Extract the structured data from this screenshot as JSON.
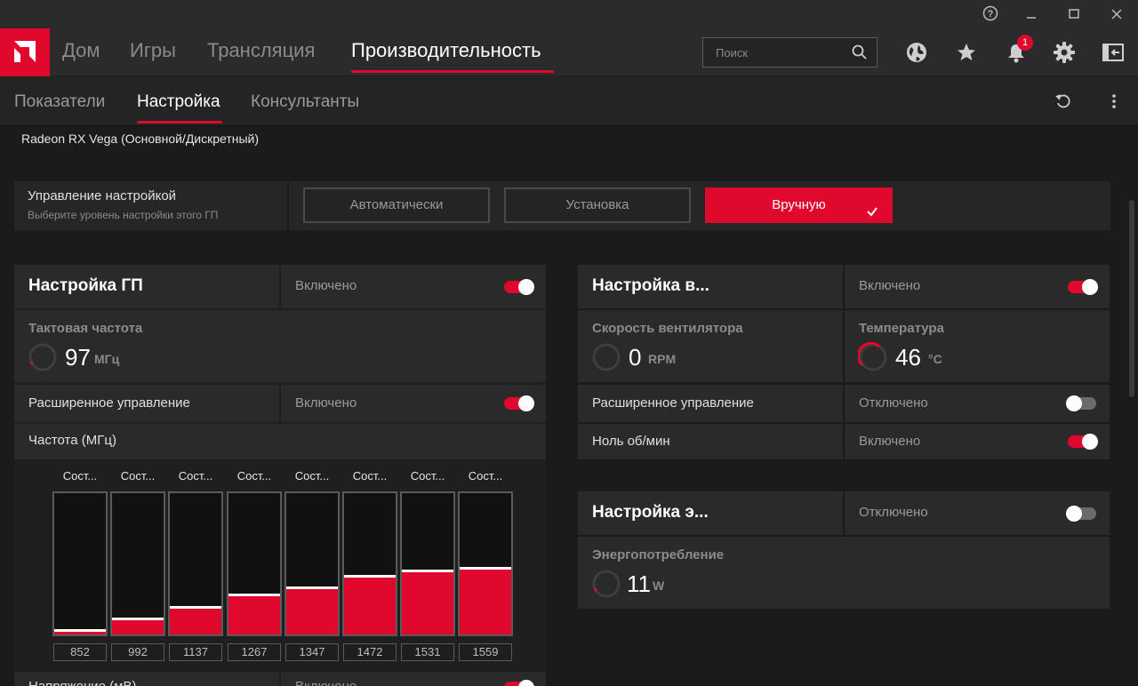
{
  "window": {
    "help_icon": "help-icon",
    "minimize_icon": "minimize-icon",
    "maximize_icon": "maximize-icon",
    "close_icon": "close-icon"
  },
  "nav": {
    "items": [
      {
        "label": "Дом"
      },
      {
        "label": "Игры"
      },
      {
        "label": "Трансляция"
      },
      {
        "label": "Производительность"
      }
    ],
    "active_index": 3,
    "search_placeholder": "Поиск",
    "notification_count": "1"
  },
  "subnav": {
    "items": [
      {
        "label": "Показатели"
      },
      {
        "label": "Настройка"
      },
      {
        "label": "Консультанты"
      }
    ],
    "active_index": 1
  },
  "gpu_name": "Radeon RX Vega (Основной/Дискретный)",
  "tuning_control": {
    "title": "Управление настройкой",
    "subtitle": "Выберите уровень настройки этого ГП",
    "options": [
      "Автоматически",
      "Установка",
      "Вручную"
    ],
    "selected_index": 2
  },
  "gpu_tuning": {
    "title": "Настройка ГП",
    "status": "Включено",
    "enabled": true,
    "clock": {
      "title": "Тактовая частота",
      "value": "97",
      "unit": "МГц"
    },
    "advanced": {
      "label": "Расширенное управление",
      "status": "Включено",
      "enabled": true
    },
    "freq_title": "Частота (МГц)",
    "states": [
      {
        "label": "Сост...",
        "value": "852",
        "level": 0.02
      },
      {
        "label": "Сост...",
        "value": "992",
        "level": 0.1
      },
      {
        "label": "Сост...",
        "value": "1137",
        "level": 0.18
      },
      {
        "label": "Сост...",
        "value": "1267",
        "level": 0.27
      },
      {
        "label": "Сост...",
        "value": "1347",
        "level": 0.32
      },
      {
        "label": "Сост...",
        "value": "1472",
        "level": 0.4
      },
      {
        "label": "Сост...",
        "value": "1531",
        "level": 0.44
      },
      {
        "label": "Сост...",
        "value": "1559",
        "level": 0.46
      }
    ],
    "voltage": {
      "label": "Напряжение (мВ)",
      "status": "Включено"
    }
  },
  "fan_tuning": {
    "title": "Настройка в...",
    "status": "Включено",
    "enabled": true,
    "fan_speed": {
      "title": "Скорость вентилятора",
      "value": "0",
      "unit": "RPM"
    },
    "temperature": {
      "title": "Температура",
      "value": "46",
      "unit": "°C"
    },
    "advanced": {
      "label": "Расширенное управление",
      "status": "Отключено",
      "enabled": false
    },
    "zero_rpm": {
      "label": "Ноль об/мин",
      "status": "Включено",
      "enabled": true
    }
  },
  "power_tuning": {
    "title": "Настройка э...",
    "status": "Отключено",
    "enabled": false,
    "power": {
      "title": "Энергопотребление",
      "value": "11",
      "unit": "W"
    }
  },
  "colors": {
    "accent": "#e0082c",
    "background": "#1b1b1b",
    "panel": "#2a2a2a"
  }
}
